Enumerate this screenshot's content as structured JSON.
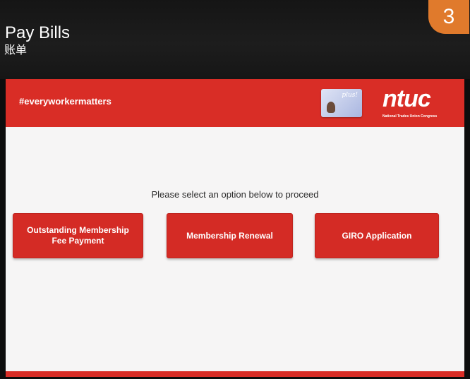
{
  "header": {
    "title": "Pay Bills",
    "subtitle": "账单",
    "step_badge": "3"
  },
  "kiosk": {
    "hashtag": "#everyworkermatters",
    "card_text": "plus!",
    "logo": "ntuc",
    "logo_subtitle": "National Trades Union Congress",
    "prompt": "Please select an option below to proceed",
    "options": [
      {
        "label": "Outstanding Membership\nFee Payment"
      },
      {
        "label": "Membership Renewal"
      },
      {
        "label": "GIRO Application"
      }
    ]
  },
  "colors": {
    "brand_red": "#d92d26",
    "badge_orange": "#e07a2c",
    "content_bg": "#f6f5f5"
  }
}
